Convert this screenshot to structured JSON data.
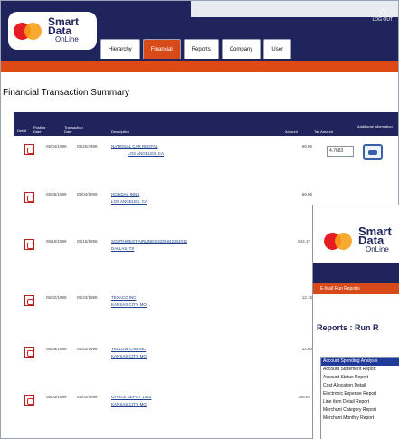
{
  "app": {
    "logo": {
      "line1": "Smart",
      "line2": "Data",
      "line3": "OnLine"
    },
    "logout": {
      "label": "LOG OUT"
    },
    "tabs": [
      {
        "label": "Hierarchy",
        "active": false
      },
      {
        "label": "Financial",
        "active": true
      },
      {
        "label": "Reports",
        "active": false
      },
      {
        "label": "Company",
        "active": false
      },
      {
        "label": "User",
        "active": false
      }
    ]
  },
  "main": {
    "title": "Financial Transaction Summary",
    "columns": {
      "detail": "Detail",
      "posting_date": "Posting Date",
      "transaction_date": "Transaction Date",
      "description": "Description",
      "amount": "Amount",
      "tax_amount": "Tax Amount",
      "additional_info": "Additional Information"
    },
    "rows": [
      {
        "posting": "05/04/1999",
        "transaction": "05/20/4999",
        "desc1": "NATIONAL CAR RENTAL",
        "desc2": "LOS ANGELES, CA",
        "amount": "69.06",
        "tax": "4.7683"
      },
      {
        "posting": "05/05/1999",
        "transaction": "05/04/1999",
        "desc1": "HOLIDAY INNS",
        "desc2": "LOS ANGELES, CA",
        "amount": "69.06",
        "tax": ""
      },
      {
        "posting": "05/15/1999",
        "transaction": "05/15/1999",
        "desc1": "SOUTHWEST AIRLINES 5265942241012",
        "desc2": "DALLAS, TX",
        "amount": "844.17",
        "tax": ""
      },
      {
        "posting": "05/02/1999",
        "transaction": "05/22/1999",
        "desc1": "TEXACO INC",
        "desc2": "KANSAS CITY, MO",
        "amount": "12.15",
        "tax": ""
      },
      {
        "posting": "05/05/1999",
        "transaction": "05/22/1999",
        "desc1": "YELLOW CAB INC",
        "desc2": "KANSAS CITY, MO",
        "amount": "12.00",
        "tax": ""
      },
      {
        "posting": "05/03/1999",
        "transaction": "05/01/1999",
        "desc1": "OFFICE DEPOT 1422",
        "desc2": "KANSAS CITY, MO",
        "amount": "206.82",
        "tax": ""
      }
    ]
  },
  "reports_window": {
    "logo": {
      "line1": "Smart",
      "line2": "Data",
      "line3": "OnLine"
    },
    "nav": "E-Mail  Run Reports",
    "title": "Reports : Run R",
    "report_list": [
      {
        "label": "Account Spending Analysis",
        "selected": true
      },
      {
        "label": "Account Statement Report",
        "selected": false
      },
      {
        "label": "Account Status Report",
        "selected": false
      },
      {
        "label": "Cost Allocation Detail",
        "selected": false
      },
      {
        "label": "Electronic Expense Report",
        "selected": false
      },
      {
        "label": "Line Item Detail Report",
        "selected": false
      },
      {
        "label": "Merchant Category Report",
        "selected": false
      },
      {
        "label": "Merchant Monthly Report",
        "selected": false
      }
    ]
  },
  "colors": {
    "navy": "#20245c",
    "orange": "#dd4a16",
    "link": "#20408f",
    "selection": "#203a9a"
  }
}
